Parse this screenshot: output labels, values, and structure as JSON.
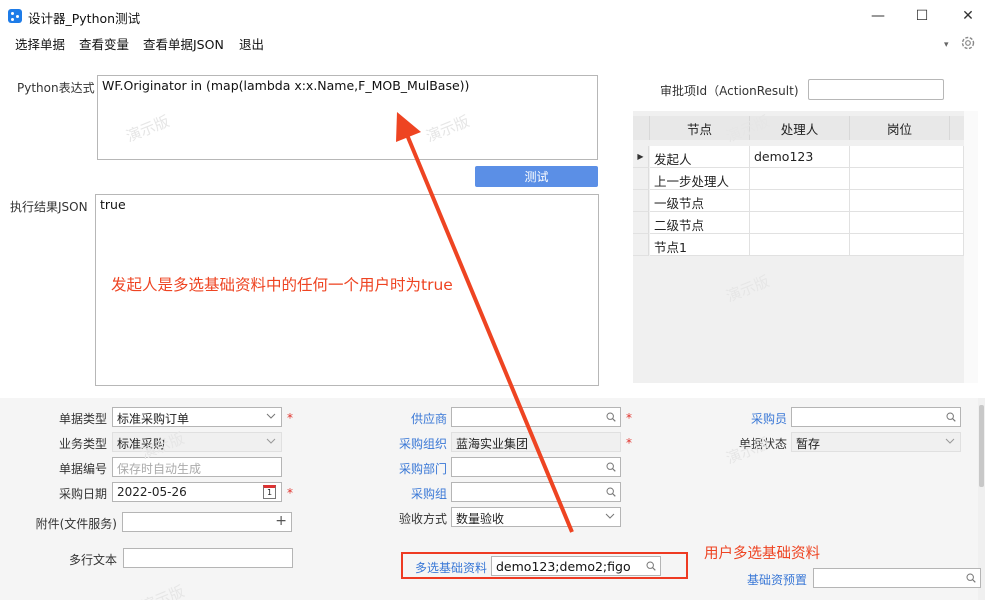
{
  "window": {
    "title": "设计器_Python测试",
    "minimize": "—",
    "maximize": "☐",
    "close": "✕"
  },
  "menu": {
    "items": [
      "选择单据",
      "查看变量",
      "查看单据JSON",
      "退出"
    ]
  },
  "top": {
    "python_label": "Python表达式",
    "python_value": "WF.Originator in (map(lambda x:x.Name,F_MOB_MulBase))",
    "test_button": "测试",
    "result_label": "执行结果JSON",
    "result_value": "true",
    "action_label": "审批项Id（ActionResult)",
    "action_value": ""
  },
  "grid": {
    "columns": [
      "节点",
      "处理人",
      "岗位"
    ],
    "rows": [
      {
        "node": "发起人",
        "handler": "demo123",
        "post": "",
        "current": true
      },
      {
        "node": "上一步处理人",
        "handler": "",
        "post": "",
        "current": false
      },
      {
        "node": "一级节点",
        "handler": "",
        "post": "",
        "current": false
      },
      {
        "node": "二级节点",
        "handler": "",
        "post": "",
        "current": false
      },
      {
        "node": "节点1",
        "handler": "",
        "post": "",
        "current": false
      }
    ]
  },
  "form": {
    "bill_type_label": "单据类型",
    "bill_type_value": "标准采购订单",
    "biz_type_label": "业务类型",
    "biz_type_value": "标准采购",
    "bill_no_label": "单据编号",
    "bill_no_placeholder": "保存时自动生成",
    "date_label": "采购日期",
    "date_value": "2022-05-26",
    "calendar_day": "1",
    "attach_label": "附件(文件服务)",
    "attach_value": "",
    "memo_label": "多行文本",
    "memo_value": "",
    "supplier_label": "供应商",
    "supplier_value": "",
    "org_label": "采购组织",
    "org_value": "蓝海实业集团",
    "dept_label": "采购部门",
    "dept_value": "",
    "group_label": "采购组",
    "group_value": "",
    "check_label": "验收方式",
    "check_value": "数量验收",
    "mulbase_label": "多选基础资料",
    "mulbase_value": "demo123;demo2;figo",
    "buyer_label": "采购员",
    "buyer_value": "",
    "status_label": "单据状态",
    "status_value": "暂存",
    "preset_label": "基础资预置",
    "preset_value": "",
    "required_mark": "*"
  },
  "annotations": {
    "note1": "发起人是多选基础资料中的任何一个用户时为true",
    "note2": "用户多选基础资料",
    "color": "#ee4422"
  },
  "watermark": "演示版"
}
